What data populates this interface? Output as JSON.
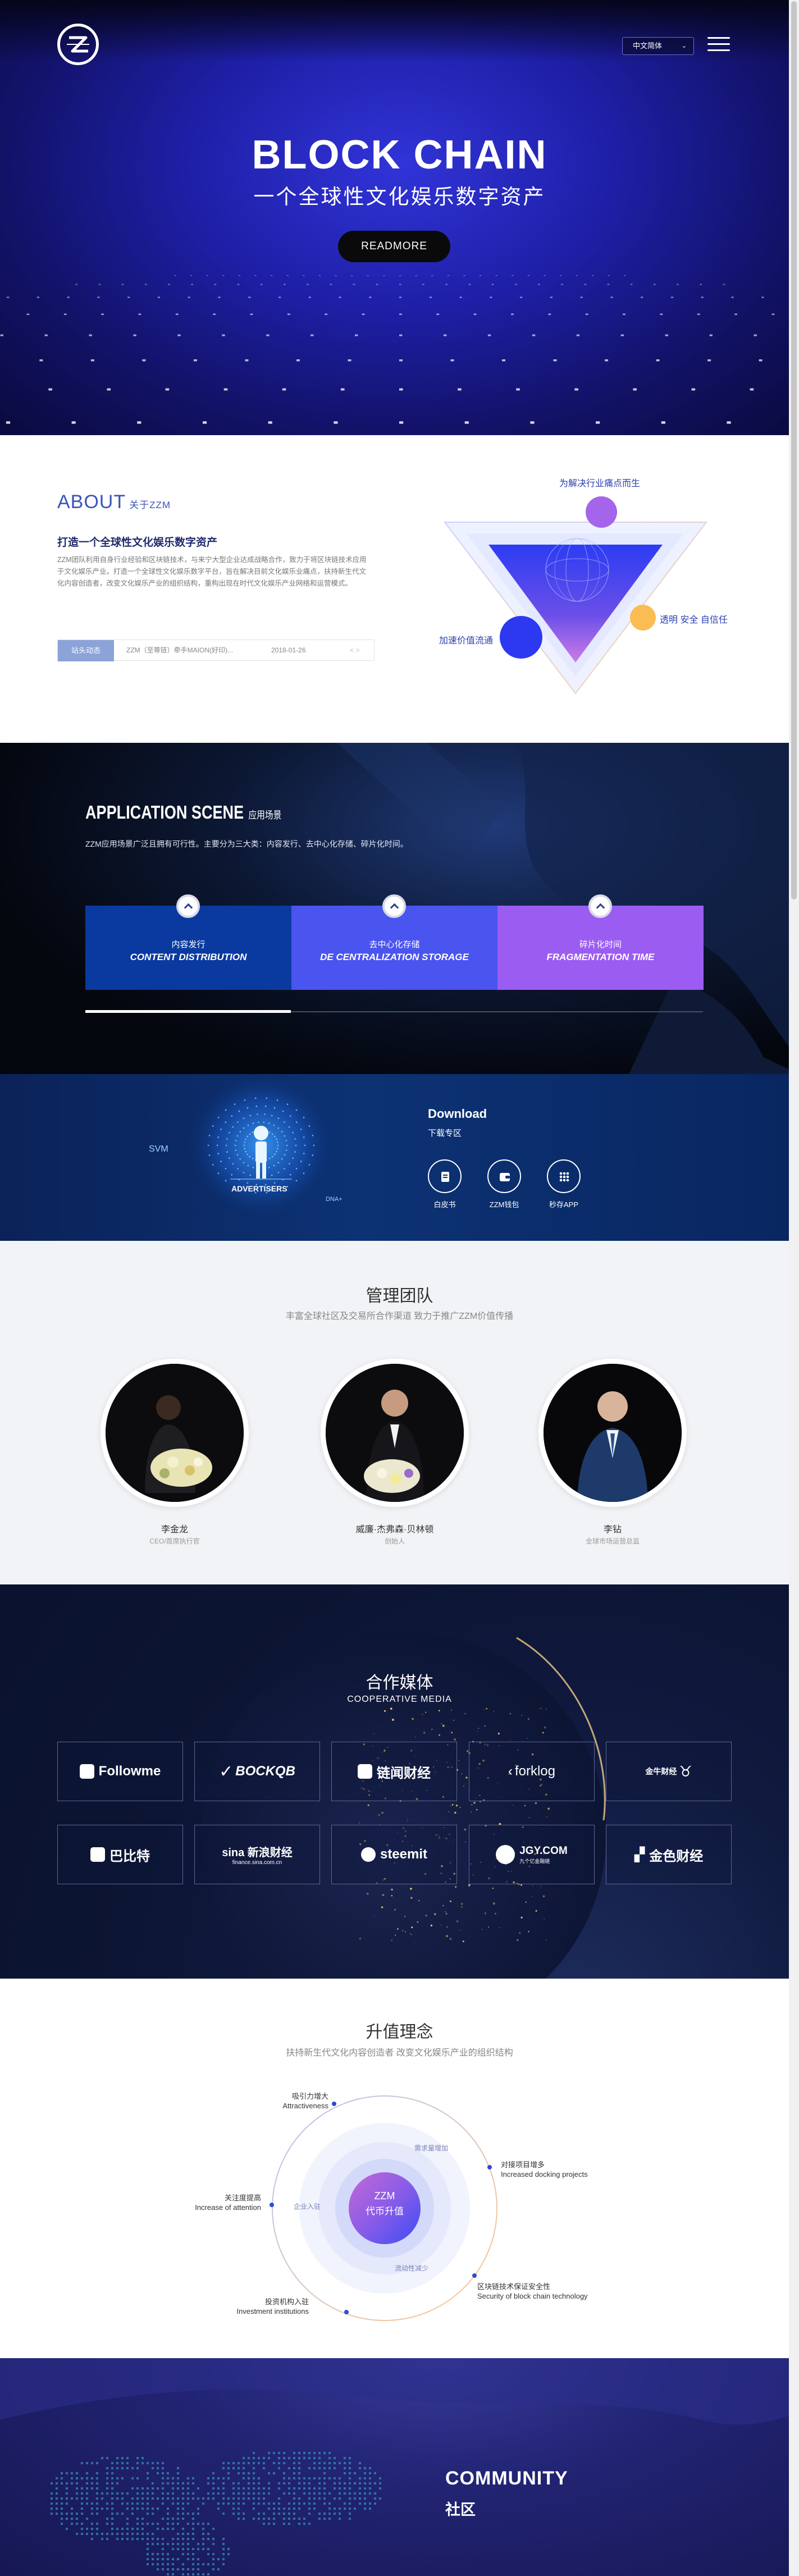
{
  "header": {
    "language": "中文简体",
    "logo_name": "ZZM"
  },
  "hero": {
    "title": "BLOCK CHAIN",
    "subtitle": "一个全球性文化娱乐数字资产",
    "button": "READMORE"
  },
  "about": {
    "heading": "ABOUT",
    "heading_small": "关于ZZM",
    "title": "打造一个全球性文化娱乐数字资产",
    "text": "ZZM团队利用自身行业经验和区块链技术，与来宁大型企业达成战略合作，致力于将区块链技术应用于文化娱乐产业。打造一个全球性文化娱乐数字平台，旨在解决目前文化娱乐业痛点，扶持新生代文化内容创造者，改变文化娱乐产业的组织结构，重构出现在时代文化娱乐产业网络和运营模式。",
    "news_tag": "站头动态",
    "news_text": "ZZM（至尊链）牵手MAION(好印)...",
    "news_date": "2018-01-26",
    "news_nav": "< >",
    "triangle_labels": {
      "top": "为解决行业痛点而生",
      "right": "透明 安全 自信任",
      "left": "加速价值流通"
    }
  },
  "application": {
    "title": "APPLICATION SCENE",
    "title_small": "应用场景",
    "desc": "ZZM应用场景广泛且拥有可行性。主要分为三大类：内容发行、去中心化存储、碎片化时间。",
    "cards": [
      {
        "cn": "内容发行",
        "en": "CONTENT DISTRIBUTION",
        "color": "#0a3aa0"
      },
      {
        "cn": "去中心化存储",
        "en": "DE CENTRALIZATION STORAGE",
        "color": "#4a54ef"
      },
      {
        "cn": "碎片化时间",
        "en": "FRAGMENTATION TIME",
        "color": "#9b5cf2"
      }
    ],
    "progress": 0.333
  },
  "download": {
    "title": "Download",
    "subtitle": "下载专区",
    "graphic_labels": {
      "svm": "SVM",
      "advertisers": "ADVERTISERS",
      "dna": "DNA+"
    },
    "items": [
      {
        "label": "白皮书",
        "icon": "document-icon"
      },
      {
        "label": "ZZM钱包",
        "icon": "wallet-icon"
      },
      {
        "label": "秒存APP",
        "icon": "grid-apps-icon"
      }
    ]
  },
  "team": {
    "title": "管理团队",
    "subtitle": "丰富全球社区及交易所合作渠道 致力于推广ZZM价值传播",
    "members": [
      {
        "name": "李金龙",
        "role": "CEO/首席执行官"
      },
      {
        "name": "威廉·杰弗森·贝林顿",
        "role": "创始人"
      },
      {
        "name": "李钻",
        "role": "全球市场运营总监"
      }
    ]
  },
  "media": {
    "title": "合作媒体",
    "subtitle": "COOPERATIVE MEDIA",
    "partners": [
      "Followme",
      "BOCKQB",
      "链闻财经",
      "forklog",
      "金牛财经",
      "巴比特",
      "sina 新浪财经",
      "steemit",
      "JGY.COM",
      "金色财经"
    ],
    "partner_small": {
      "sina": "finance.sina.com.cn",
      "jgy": "九个亿金融链"
    }
  },
  "value": {
    "title": "升值理念",
    "subtitle": "扶持新生代文化内容创造者 改变文化娱乐产业的组织结构",
    "center_en": "ZZM",
    "center_cn": "代币升值",
    "inner_labels": {
      "top": "需求量增加",
      "left": "企业入驻",
      "bottom": "流动性减少"
    },
    "points": [
      {
        "cn": "吸引力增大",
        "en": "Attractiveness"
      },
      {
        "cn": "对接项目增多",
        "en": "Increased docking projects"
      },
      {
        "cn": "关注度提高",
        "en": "Increase of attention"
      },
      {
        "cn": "区块链技术保证安全性",
        "en": "Security of block chain technology"
      },
      {
        "cn": "投资机构入驻",
        "en": "Investment institutions"
      }
    ]
  },
  "community": {
    "title": "COMMUNITY",
    "subtitle": "社区"
  }
}
